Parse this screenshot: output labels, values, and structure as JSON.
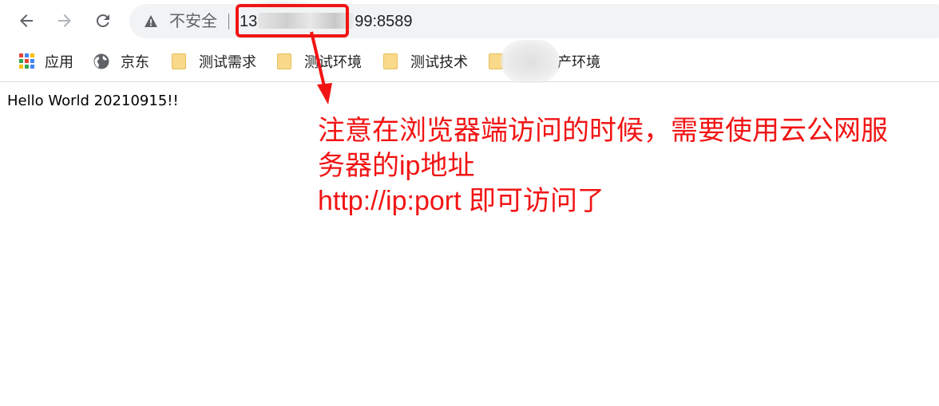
{
  "toolbar": {
    "back_icon": "arrow-left-icon",
    "forward_icon": "arrow-right-icon",
    "reload_icon": "reload-icon",
    "security_label": "不安全",
    "url_prefix": "13",
    "url_suffix": "99:8589"
  },
  "bookmarks": [
    {
      "label": "应用",
      "icon": "apps-grid-icon"
    },
    {
      "label": "京东",
      "icon": "globe-icon"
    },
    {
      "label": "测试需求",
      "icon": "folder-icon"
    },
    {
      "label": "测试环境",
      "icon": "folder-icon"
    },
    {
      "label": "测试技术",
      "icon": "folder-icon"
    },
    {
      "label": "产环境",
      "icon": "folder-icon"
    }
  ],
  "page": {
    "content_text": "Hello World 20210915!!"
  },
  "annotation": {
    "line1": "注意在浏览器端访问的时候，需要使用云公网服",
    "line2": "务器的ip地址",
    "line3": "http://ip:port 即可访问了",
    "color": "#f21414"
  }
}
